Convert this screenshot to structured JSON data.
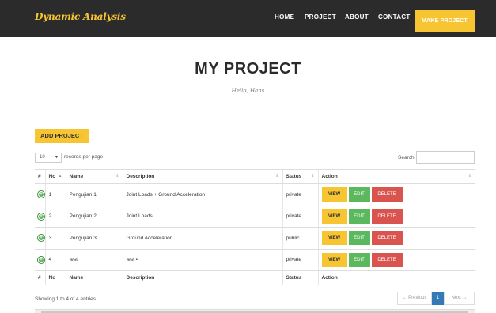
{
  "nav": {
    "brand": "Dynamic Analysis",
    "items": [
      "HOME",
      "PROJECT",
      "ABOUT",
      "CONTACT"
    ],
    "cta": "MAKE PROJECT"
  },
  "header": {
    "title": "MY PROJECT",
    "greeting": "Hello, Hans"
  },
  "toolbar": {
    "add_label": "ADD PROJECT",
    "length_value": "10",
    "length_label": "records per page",
    "search_label": "Search:",
    "search_value": ""
  },
  "table": {
    "columns": [
      "#",
      "No",
      "Name",
      "Description",
      "Status",
      "Action"
    ],
    "rows": [
      {
        "no": "1",
        "name": "Pengujian 1",
        "description": "Joint Loads + Ground Acceleration",
        "status": "private"
      },
      {
        "no": "2",
        "name": "Pengujian 2",
        "description": "Joint Loads",
        "status": "private"
      },
      {
        "no": "3",
        "name": "Pengujian 3",
        "description": "Ground Acceleration",
        "status": "public"
      },
      {
        "no": "4",
        "name": "test",
        "description": "test 4",
        "status": "private"
      }
    ],
    "actions": {
      "view": "VIEW",
      "edit": "EDIT",
      "delete": "DELETE"
    },
    "expand_symbol": "+"
  },
  "footer": {
    "info": "Showing 1 to 4 of 4 entries",
    "prev": "← Previous",
    "current": "1",
    "next": "Next →"
  },
  "colors": {
    "accent": "#f7c531",
    "navbar": "#2b2b2b",
    "edit": "#5cb85c",
    "delete": "#d9534f",
    "pager_active": "#337ab7"
  }
}
